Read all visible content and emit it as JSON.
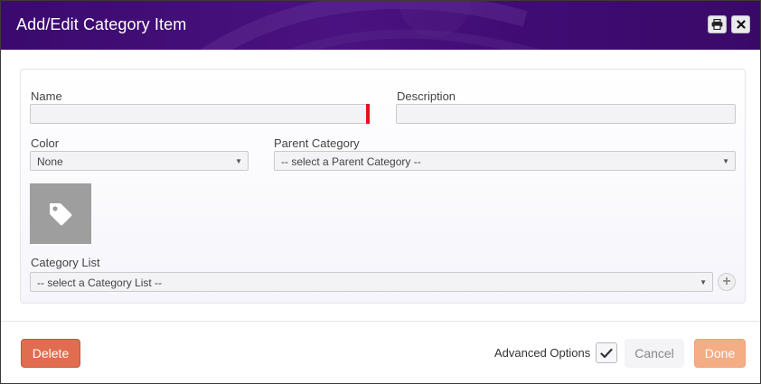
{
  "window": {
    "title": "Add/Edit Category Item",
    "print_icon": "printer-icon",
    "close_icon": "close-icon"
  },
  "form": {
    "name": {
      "label": "Name",
      "value": "",
      "required": true
    },
    "description": {
      "label": "Description",
      "value": ""
    },
    "color": {
      "label": "Color",
      "selected": "None"
    },
    "parent_category": {
      "label": "Parent Category",
      "selected": "-- select a Parent Category --"
    },
    "icon": {
      "name": "tag-icon",
      "background": "#9e9e9e"
    },
    "category_list": {
      "label": "Category List",
      "selected": "-- select a Category List --",
      "add_icon": "plus-icon"
    }
  },
  "footer": {
    "delete_label": "Delete",
    "advanced_options_label": "Advanced Options",
    "advanced_options_checked": true,
    "cancel_label": "Cancel",
    "done_label": "Done"
  },
  "colors": {
    "titlebar": "#3b0a6e",
    "delete": "#e06d4f",
    "done": "#f4ad85",
    "required_marker": "#e0131f"
  }
}
